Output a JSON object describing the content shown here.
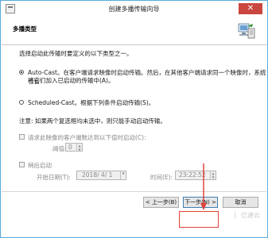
{
  "window": {
    "title": "创建多播传输向导",
    "close_glyph": "✕"
  },
  "header": {
    "title": "多播类型"
  },
  "content": {
    "intro": "选择启动此传输时要定义的以下类型之一。",
    "option_autocast_line1": "Auto-Cast。在客户端请求映像时启动传输。然后，在其他客户端请求同一个映像时，系统也会",
    "option_autocast_line2": "将它们加入已启动的传输中(A)。",
    "option_scheduled": "Scheduled-Cast。根据下列条件启动传输(S)。",
    "note": "注意: 如果两个复选框均未选中，则只能手动启动传输。",
    "threshold_checkbox": "请求此映像的客户端数达到以下值时启动(C):",
    "threshold_label": "阈值(R):",
    "threshold_value": "0",
    "schedule_checkbox": "稍后启动",
    "start_date_label": "开始日期(T):",
    "start_date_value": "2018/ 4/ 1",
    "time_label": "时间(E):",
    "time_value": "23:22:52"
  },
  "footer": {
    "back_label": "< 上一步(B)",
    "next_label": "下一步(N) >",
    "cancel_label": "取消",
    "watermark": "│ 亿速云"
  },
  "colors": {
    "accent_border": "#5aa8d8",
    "annotation_red": "#e0433b"
  }
}
